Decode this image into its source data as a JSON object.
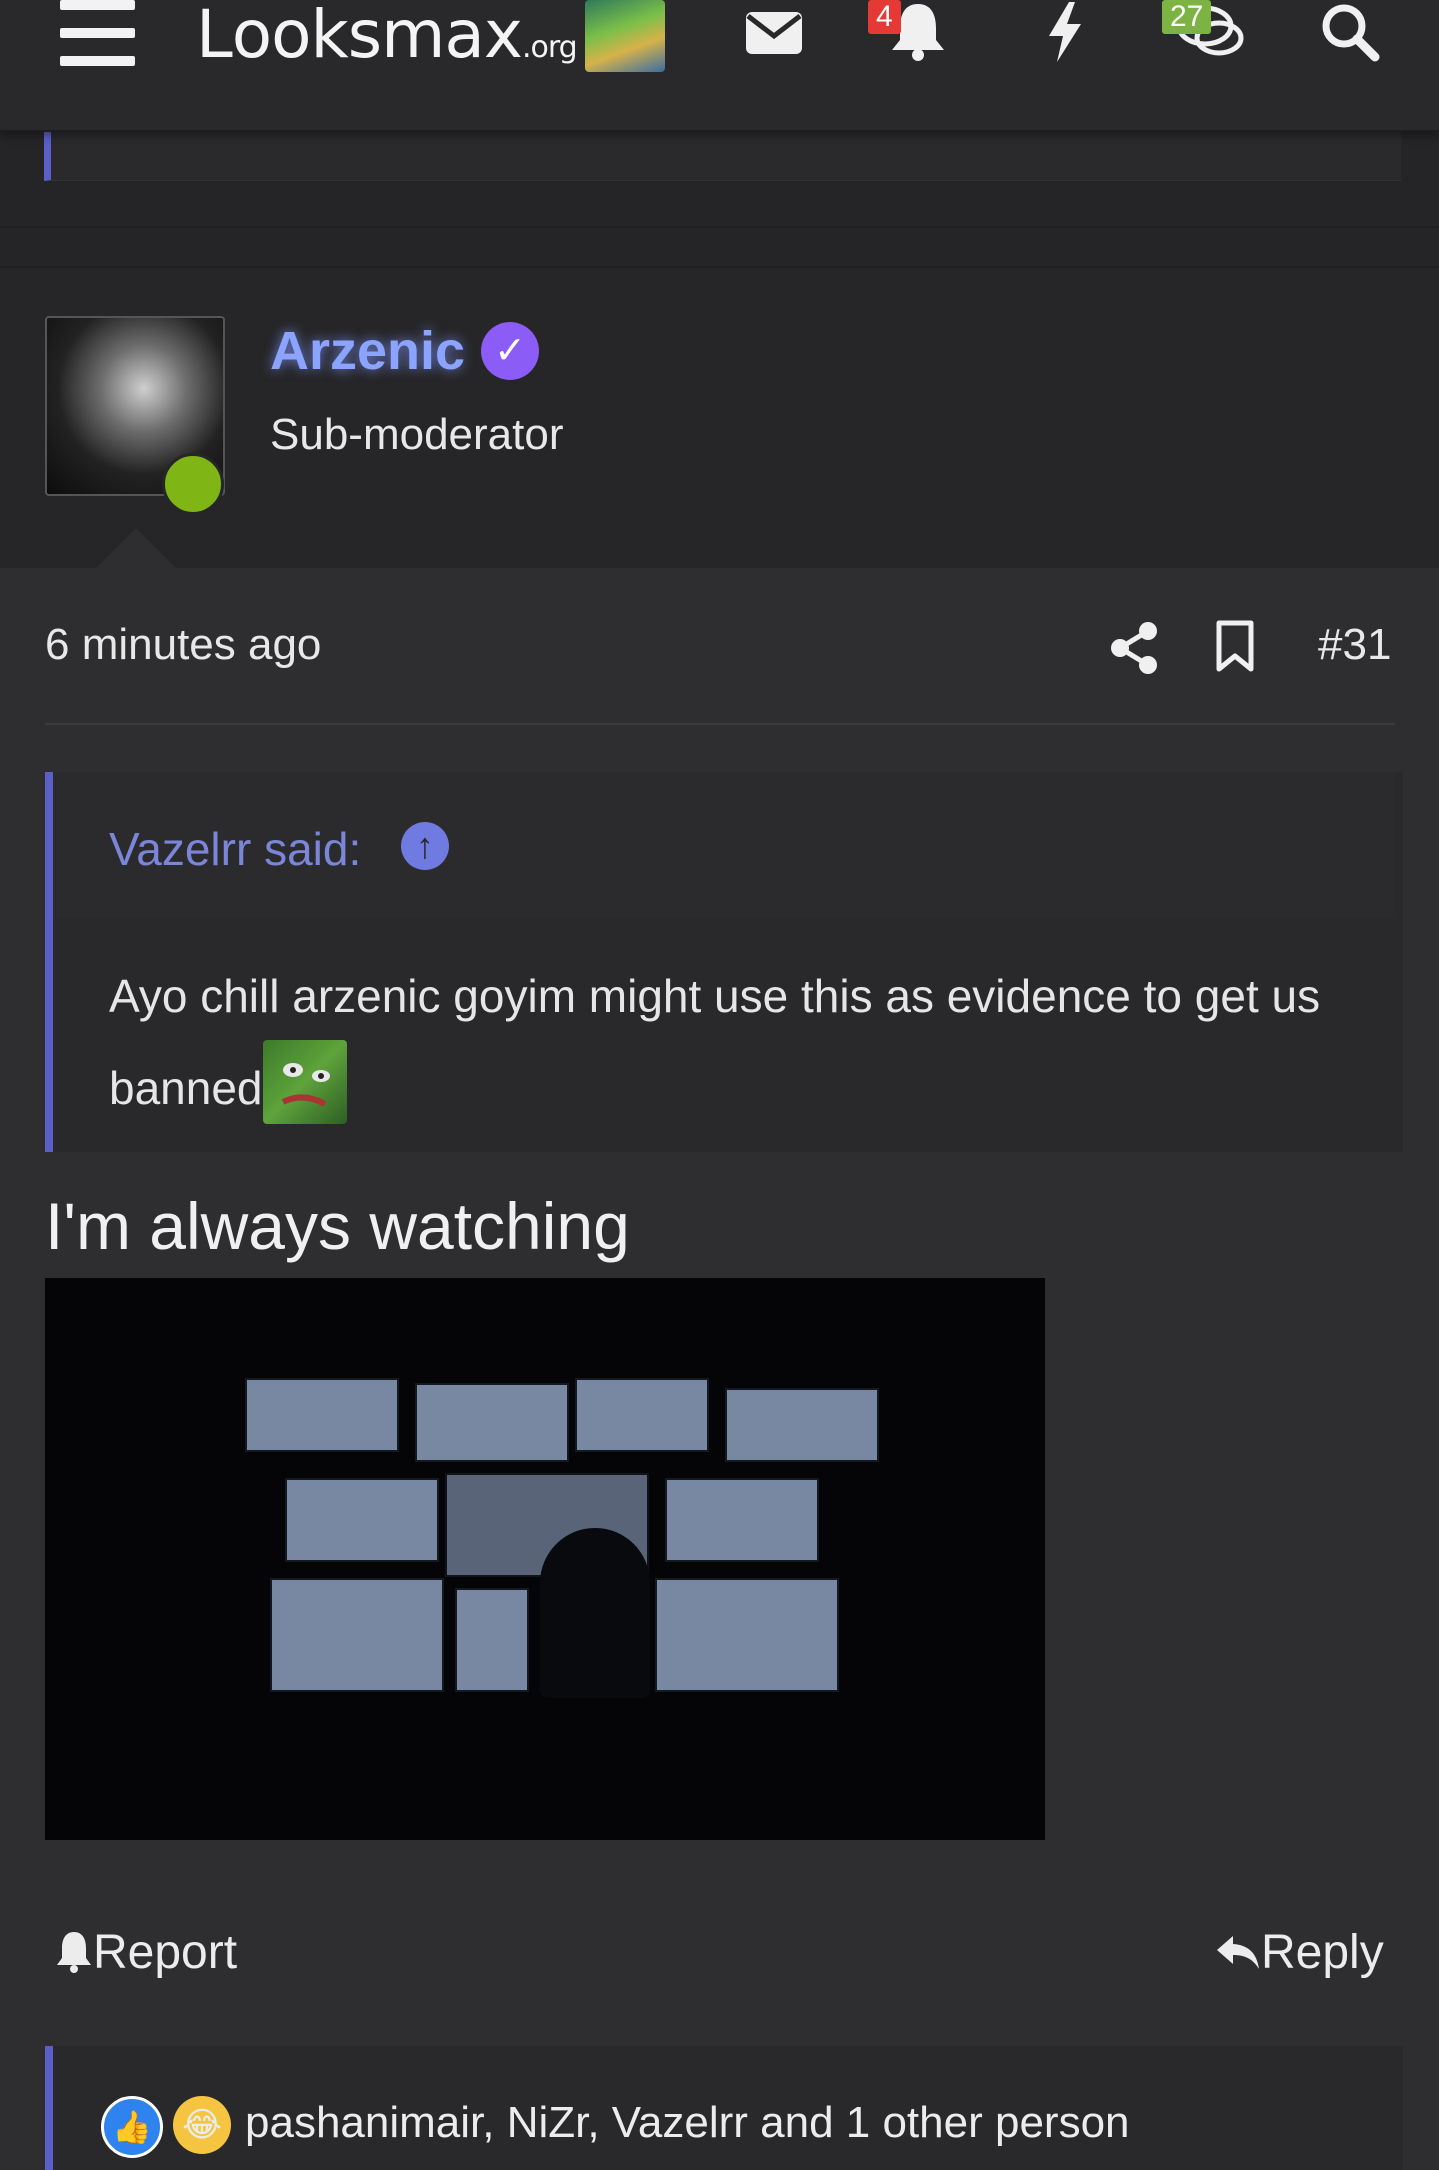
{
  "header": {
    "logo_main": "Lᴏᴏksmax",
    "logo_suffix": ".org",
    "notifications_badge": "4",
    "conversations_badge": "27",
    "icons": [
      "menu-icon",
      "envelope-icon",
      "bell-icon",
      "lightning-icon",
      "comments-icon",
      "search-icon"
    ]
  },
  "post": {
    "author": "Arzenic",
    "user_title": "Sub-moderator",
    "time": "6 minutes ago",
    "post_number": "#31",
    "quote": {
      "author_label": "Vazelrr said:",
      "text": "Ayo chill arzenic goyim might use this as evidence to get us banned"
    },
    "message": "I'm always watching",
    "actions": {
      "report": "Report",
      "reply": "Reply"
    },
    "reactions_text": "pashanimair, NiZr, Vazelrr and 1 other person"
  },
  "colors": {
    "background": "#2e2e31",
    "accent": "#5b5fc7",
    "username": "#8aa4ff",
    "online": "#7fb514",
    "verified": "#8b5cf6",
    "alert_badge": "#e53935",
    "convo_badge": "#7cb342"
  }
}
